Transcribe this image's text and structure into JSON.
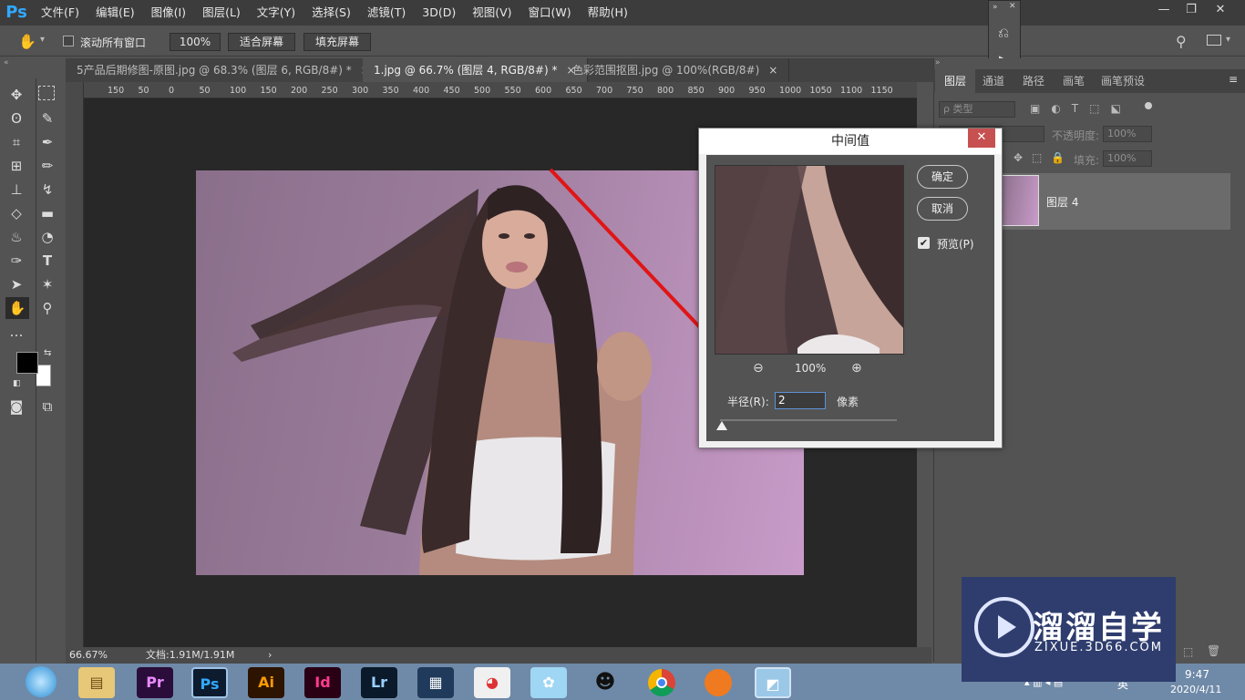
{
  "app": {
    "logo": "Ps"
  },
  "menu": [
    "文件(F)",
    "编辑(E)",
    "图像(I)",
    "图层(L)",
    "文字(Y)",
    "选择(S)",
    "滤镜(T)",
    "3D(D)",
    "视图(V)",
    "窗口(W)",
    "帮助(H)"
  ],
  "window_controls": {
    "minimize": "—",
    "restore": "❐",
    "close": "✕"
  },
  "options": {
    "scroll_all": "滚动所有窗口",
    "zoom_value": "100%",
    "fit_screen": "适合屏幕",
    "fill_screen": "填充屏幕"
  },
  "tabs": [
    {
      "label": "5产品后期修图-原图.jpg @ 68.3% (图层 6, RGB/8#) *",
      "close": "×"
    },
    {
      "label": "1.jpg @ 66.7% (图层 4, RGB/8#) *",
      "close": "×"
    },
    {
      "label": "色彩范围抠图.jpg @ 100%(RGB/8#)",
      "close": "×"
    }
  ],
  "ruler_h": [
    "150",
    "50",
    "0",
    "50",
    "100",
    "150",
    "200",
    "250",
    "300",
    "350",
    "400",
    "450",
    "500",
    "550",
    "600",
    "650",
    "700",
    "750",
    "800",
    "850",
    "900",
    "950",
    "1000",
    "1050",
    "1100",
    "1150"
  ],
  "status": {
    "zoom": "66.67%",
    "doc": "文档:1.91M/1.91M",
    "arrow": "›"
  },
  "right_panel": {
    "tabs": [
      "图层",
      "通道",
      "路径",
      "画笔",
      "画笔预设"
    ],
    "filter_kind": "ρ 类型",
    "opacity_label": "不透明度:",
    "opacity_value": "100%",
    "fill_label": "填充:",
    "fill_value": "100%",
    "layer_name": "图层 4"
  },
  "dialog": {
    "title": "中间值",
    "close": "✕",
    "ok": "确定",
    "cancel": "取消",
    "preview_label": "预览(P)",
    "preview_checked": true,
    "zoom": "100%",
    "radius_label": "半径(R):",
    "radius_value": "2",
    "radius_unit": "像素"
  },
  "taskbar": {
    "apps": [
      {
        "name": "Pr",
        "color": "#2a0d3a",
        "fg": "#e98bff"
      },
      {
        "name": "Ps",
        "color": "#0d1b2e",
        "fg": "#31a8ff"
      },
      {
        "name": "Ai",
        "color": "#2c1400",
        "fg": "#ff9a00"
      },
      {
        "name": "Id",
        "color": "#2a0014",
        "fg": "#ff3b8e"
      },
      {
        "name": "Lr",
        "color": "#0a1a2a",
        "fg": "#9ad0ff"
      }
    ],
    "clock_time": "9:47",
    "clock_date": "2020/4/11",
    "ime": "英"
  },
  "watermark": {
    "brand": "溜溜自学",
    "url": "ZIXUE.3D66.COM"
  }
}
